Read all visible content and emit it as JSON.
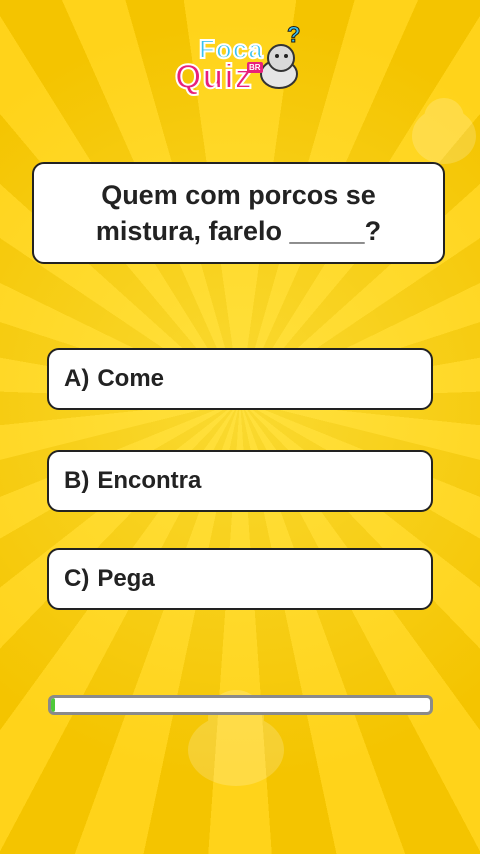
{
  "logo": {
    "line1": "Foca",
    "line2": "Quiz",
    "badge": "BR"
  },
  "question": {
    "text": "Quem com porcos se\nmistura, farelo _____?"
  },
  "options": [
    {
      "label": "A)",
      "text": "Come"
    },
    {
      "label": "B)",
      "text": "Encontra"
    },
    {
      "label": "C)",
      "text": "Pega"
    }
  ],
  "timer": {
    "progress_fraction": 0.01
  },
  "colors": {
    "background": "#f7c600",
    "progress": "#4ec93a",
    "logo_blue": "#39c2f0",
    "logo_pink": "#e8207a"
  }
}
